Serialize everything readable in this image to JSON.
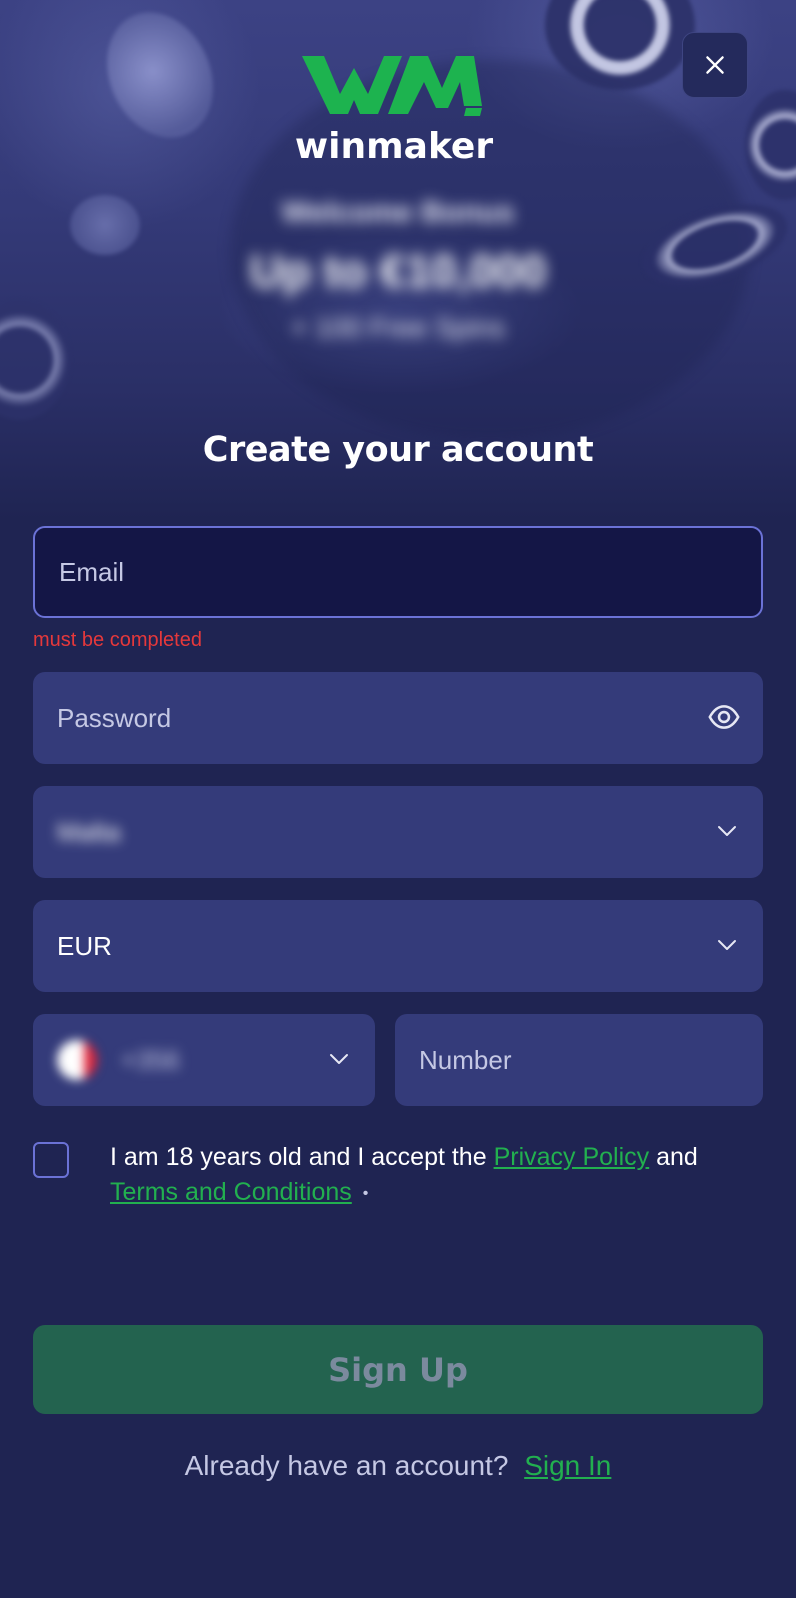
{
  "brand": {
    "name": "winmaker",
    "accent_color": "#22b04f"
  },
  "close_icon": "close-icon",
  "bonus": {
    "line1": "Welcome Bonus",
    "line2": "Up to €10,000",
    "line3": "+ 100 Free Spins"
  },
  "form": {
    "title": "Create your account",
    "email": {
      "placeholder": "Email",
      "error": "must be completed"
    },
    "password": {
      "placeholder": "Password",
      "icon": "eye-icon"
    },
    "region_select": {
      "value": "Malta",
      "icon": "chevron-down-icon"
    },
    "currency_select": {
      "value": "EUR",
      "icon": "chevron-down-icon"
    },
    "phone_code": {
      "value": "+356",
      "icon": "chevron-down-icon"
    },
    "phone_number": {
      "placeholder": "Number"
    },
    "consent": {
      "text_before": "I am 18 years old and I accept the",
      "privacy_link": "Privacy Policy",
      "text_middle": "and",
      "terms_link": "Terms and Conditions",
      "required_mark": "•"
    },
    "submit_label": "Sign Up",
    "signin_prompt": "Already have an account?",
    "signin_link": "Sign In"
  }
}
